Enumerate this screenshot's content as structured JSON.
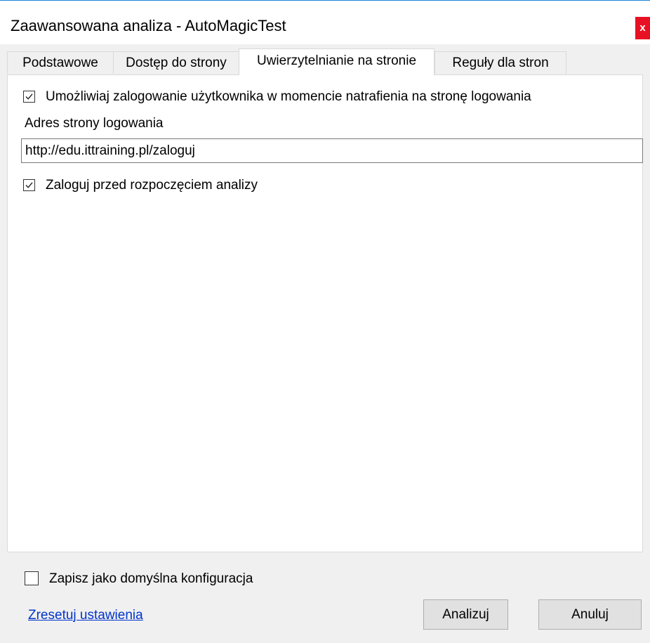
{
  "window": {
    "title": "Zaawansowana analiza - AutoMagicTest",
    "close_glyph": "x",
    "accent_color": "#1883d7",
    "close_color": "#e81123"
  },
  "tabs": [
    {
      "label": "Podstawowe",
      "active": false
    },
    {
      "label": "Dostęp do strony",
      "active": false
    },
    {
      "label": "Uwierzytelnianie na stronie",
      "active": true
    },
    {
      "label": "Reguły dla stron",
      "active": false
    }
  ],
  "auth": {
    "enable_login_checkbox": {
      "label": "Umożliwiaj zalogowanie użytkownika w momencie natrafienia na stronę logowania",
      "checked": true
    },
    "login_url_label": "Adres strony logowania",
    "login_url_value": "http://edu.ittraining.pl/zaloguj",
    "login_before_checkbox": {
      "label": "Zaloguj przed rozpoczęciem analizy",
      "checked": true
    }
  },
  "footer": {
    "save_default_checkbox": {
      "label": "Zapisz jako domyślna konfiguracja",
      "checked": false
    },
    "reset_link": "Zresetuj ustawienia",
    "analyze_button": "Analizuj",
    "cancel_button": "Anuluj",
    "link_color": "#0033cc"
  }
}
